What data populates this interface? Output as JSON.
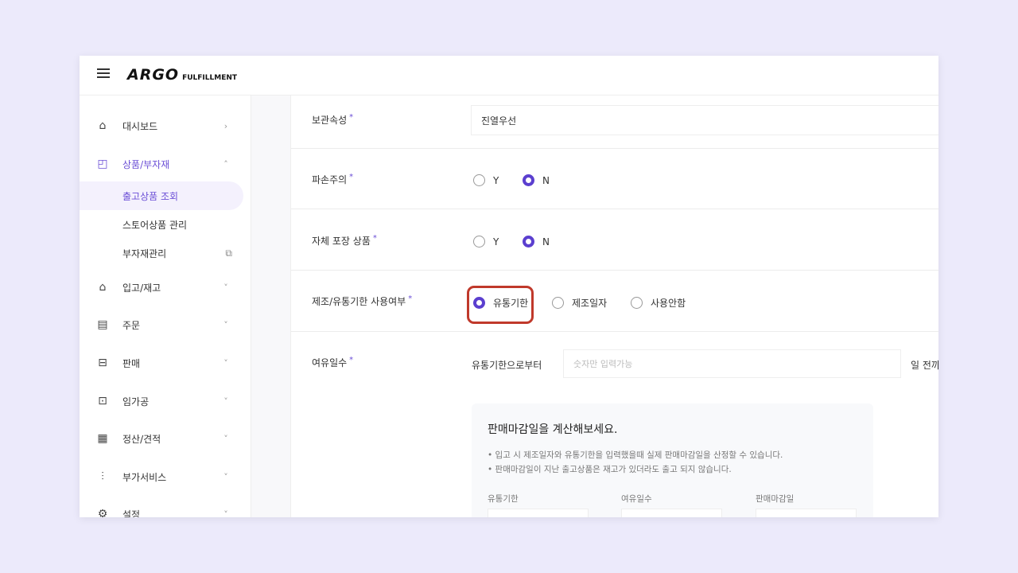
{
  "header": {
    "logo": "ARGO",
    "logo_sub": "FULFILLMENT"
  },
  "sidebar": {
    "items": [
      {
        "label": "대시보드",
        "icon": "home-icon",
        "chevron": "›"
      },
      {
        "label": "상품/부자재",
        "icon": "bag-icon",
        "chevron": "˄",
        "active": true
      },
      {
        "label": "입고/재고",
        "icon": "warehouse-icon",
        "chevron": "˅"
      },
      {
        "label": "주문",
        "icon": "order-search-icon",
        "chevron": "˅"
      },
      {
        "label": "판매",
        "icon": "store-icon",
        "chevron": "˅"
      },
      {
        "label": "임가공",
        "icon": "tray-icon",
        "chevron": "˅"
      },
      {
        "label": "정산/견적",
        "icon": "calculator-icon",
        "chevron": "˅"
      },
      {
        "label": "부가서비스",
        "icon": "chart-plus-icon",
        "chevron": "˅"
      },
      {
        "label": "설정",
        "icon": "gear-icon",
        "chevron": "˅"
      }
    ],
    "subitems": [
      {
        "label": "출고상품 조회",
        "selected": true
      },
      {
        "label": "스토어상품 관리"
      },
      {
        "label": "부자재관리",
        "icon": "external-link-icon"
      }
    ]
  },
  "form": {
    "required_mark": "*",
    "storage": {
      "label": "보관속성",
      "value": "진열우선"
    },
    "fragile": {
      "label": "파손주의",
      "options": [
        "Y",
        "N"
      ],
      "selected": "N"
    },
    "own_packaging": {
      "label": "자체 포장 상품",
      "options": [
        "Y",
        "N"
      ],
      "selected": "N"
    },
    "date_usage": {
      "label": "제조/유통기한 사용여부",
      "options": [
        "유통기한",
        "제조일자",
        "사용안함"
      ],
      "selected": "유통기한"
    },
    "margin_days": {
      "label": "여유일수",
      "prefix": "유통기한으로부터",
      "placeholder": "숫자만 입력가능",
      "suffix": "일 전까"
    }
  },
  "calculator": {
    "title": "판매마감일을 계산해보세요.",
    "notes": [
      "입고 시 제조일자와 유통기한을 입력했을때 실제 판매마감일을 산정할 수 있습니다.",
      "판매마감일이 지난 출고상품은 재고가 있더라도 출고 되지 않습니다."
    ],
    "columns": [
      "유통기한",
      "여유일수",
      "판매마감일"
    ]
  },
  "colors": {
    "accent": "#5b3fcf",
    "highlight": "#c0392b",
    "background": "#eceafb"
  }
}
